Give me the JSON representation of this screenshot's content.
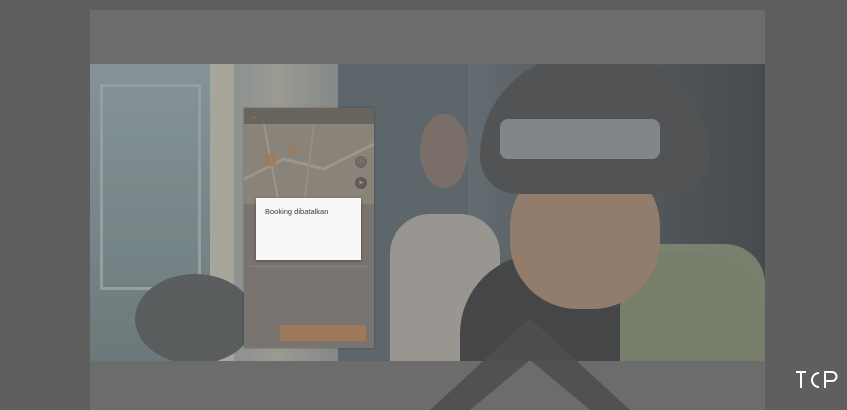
{
  "video": {
    "scene": "motorcycle-taxi-driver",
    "overlay_phone": {
      "header_title": "",
      "map_buttons": [
        "locate-icon",
        "navigation-icon"
      ],
      "dialog": {
        "title": "Booking dibatalkan",
        "body": "",
        "ok_label": ""
      },
      "sheet": {
        "row1_label": "",
        "row1_value": "",
        "row2_label": "",
        "row2_value": "",
        "cta_label": "",
        "cancel_label": ""
      }
    }
  },
  "controls": {
    "play_overlay_icon": "chevron-up-icon"
  },
  "branding": {
    "logo_icon": "tcp-logo-icon"
  },
  "colors": {
    "frame": "#5f5f5f",
    "panel": "#6c6c6c",
    "dialog_bg": "#f8f8f8",
    "dialog_title": "#3a3a3a",
    "cta": "#a0785a"
  }
}
